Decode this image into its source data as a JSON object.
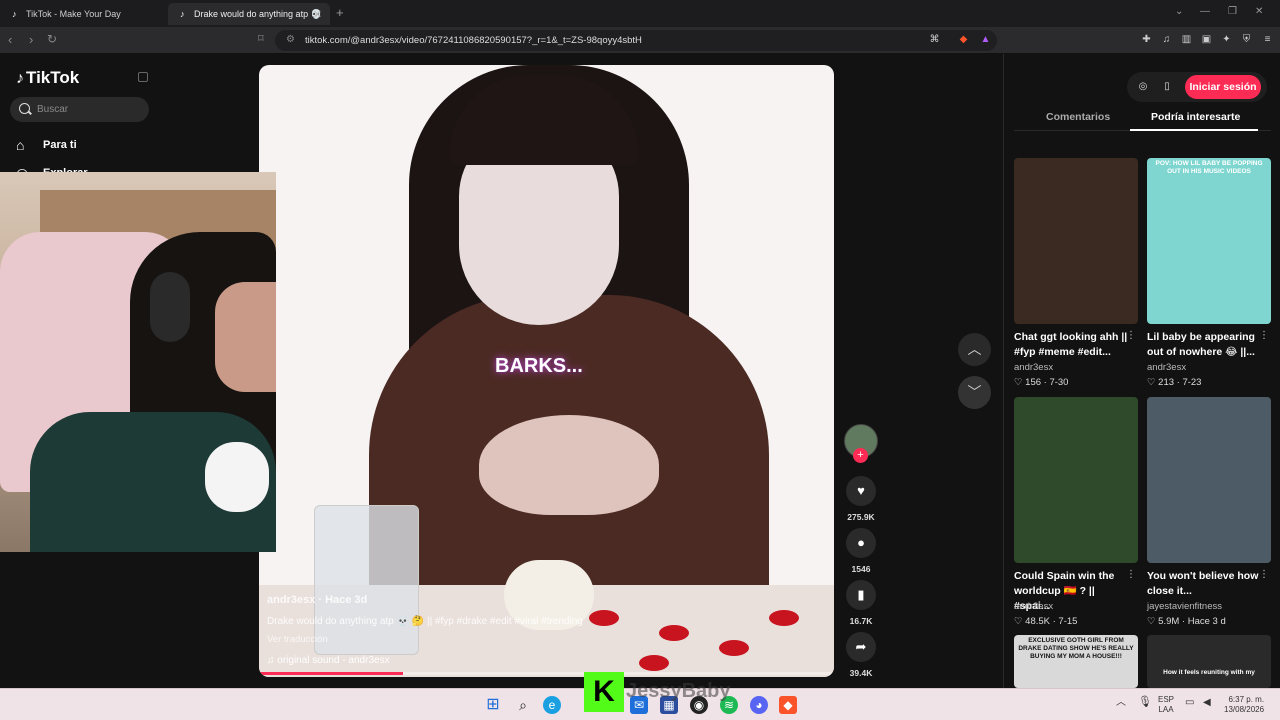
{
  "browser": {
    "tabs": [
      {
        "title": "TikTok - Make Your Day",
        "active": false
      },
      {
        "title": "Drake would do anything atp 💀",
        "active": true
      }
    ],
    "new_tab": "+",
    "url": "tiktok.com/@andr3esx/video/7672411086820590157?_r=1&_t=ZS-98qoyy4sbtH"
  },
  "sidebar": {
    "logo": "TikTok",
    "search_placeholder": "Buscar",
    "items": [
      {
        "label": "Para ti",
        "icon": "home-icon"
      },
      {
        "label": "Explorar",
        "icon": "compass-icon"
      }
    ]
  },
  "video": {
    "overlay_text": "BARKS...",
    "author": "andr3esx · Hace 3d",
    "description": "Drake would do anything atp 💀 🤔 || #fyp #drake #edit #viral #trending",
    "translate": "Ver traducción",
    "sound": "♫  original sound - andr3esx",
    "progress": 0.25
  },
  "actions": {
    "likes": "275.9K",
    "comments": "1546",
    "saves": "16.7K",
    "shares": "39.4K"
  },
  "right_panel": {
    "login": "Iniciar sesión",
    "tabs": [
      {
        "label": "Comentarios",
        "active": false
      },
      {
        "label": "Podría interesarte",
        "active": true
      }
    ],
    "cards": [
      {
        "title": "Chat ggt looking ahh || #fyp #meme #edit...",
        "author": "andr3esx",
        "stats": "♡ 156 · 7-30",
        "caption": "",
        "thumb": "#3a2a22"
      },
      {
        "title": "Lil baby be appearing out of nowhere 😂 ||...",
        "author": "andr3esx",
        "stats": "♡ 213 · 7-23",
        "caption": "POV: HOW LIL BABY BE POPPING OUT IN HIS MUSIC VIDEOS",
        "thumb": "#7fd6d0"
      },
      {
        "title": "Could Spain win the worldcup 🇪🇸 ? || #spai...",
        "author": "andr3esx",
        "stats": "♡ 48.5K · 7-15",
        "caption": "",
        "thumb": "#2f4a2a"
      },
      {
        "title": "You won't believe how close it...",
        "author": "jayestavienfitness",
        "stats": "♡ 5.9M · Hace 3 d",
        "caption": "",
        "thumb": "#4d5b66"
      },
      {
        "title": "",
        "author": "",
        "stats": "",
        "caption": "EXCLUSIVE GOTH GIRL FROM DRAKE DATING SHOW HE'S REALLY BUYING MY MOM A HOUSE!!!",
        "thumb": "#d9d9d9"
      },
      {
        "title": "",
        "author": "",
        "stats": "",
        "caption": "How it feels reuniting with my",
        "thumb": "#2a2a2a"
      }
    ]
  },
  "stream_overlay": {
    "kick_logo": "K",
    "streamer": "JessyBaby"
  },
  "taskbar": {
    "lang": "ESP",
    "layout": "LAA",
    "time": "6:37 p. m.",
    "date": "13/08/2026"
  },
  "colors": {
    "accent": "#fe2c55",
    "kick": "#53fc18"
  }
}
